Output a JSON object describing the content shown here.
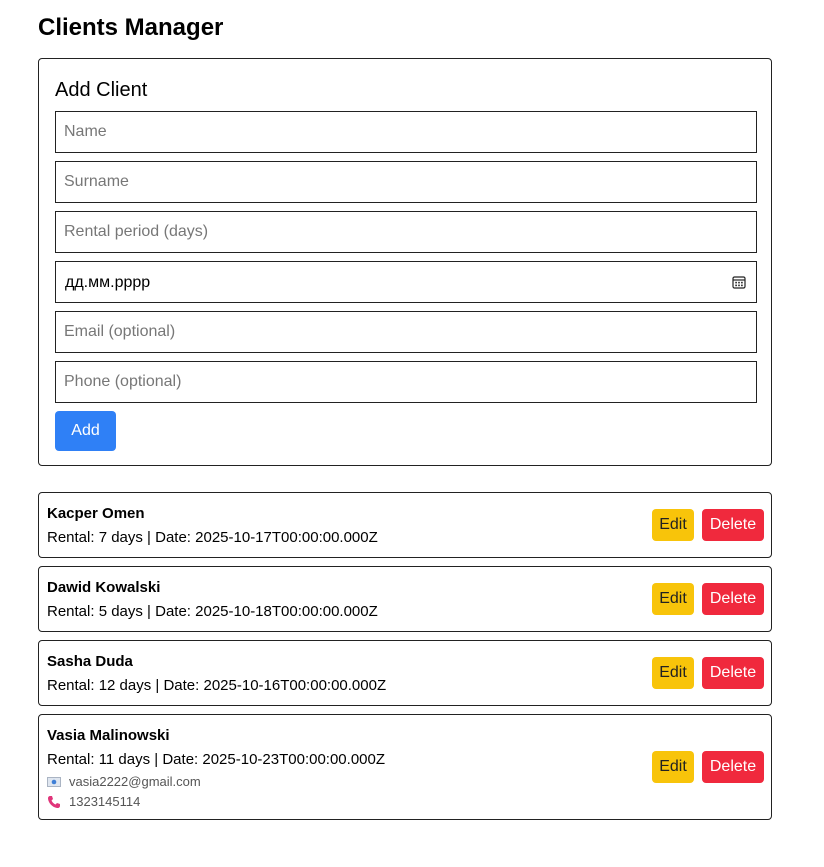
{
  "header": {
    "title": "Clients Manager"
  },
  "form": {
    "title": "Add Client",
    "name_placeholder": "Name",
    "surname_placeholder": "Surname",
    "rental_placeholder": "Rental period (days)",
    "date_value": "дд.мм.рррр",
    "email_placeholder": "Email (optional)",
    "phone_placeholder": "Phone (optional)",
    "add_label": "Add"
  },
  "clients": [
    {
      "name": "Kacper Omen",
      "info": "Rental: 7 days | Date: 2025-10-17T00:00:00.000Z",
      "edit_label": "Edit",
      "delete_label": "Delete"
    },
    {
      "name": "Dawid Kowalski",
      "info": "Rental: 5 days | Date: 2025-10-18T00:00:00.000Z",
      "edit_label": "Edit",
      "delete_label": "Delete"
    },
    {
      "name": "Sasha Duda",
      "info": "Rental: 12 days | Date: 2025-10-16T00:00:00.000Z",
      "edit_label": "Edit",
      "delete_label": "Delete"
    },
    {
      "name": "Vasia Malinowski",
      "info": "Rental: 11 days | Date: 2025-10-23T00:00:00.000Z",
      "email": "vasia2222@gmail.com",
      "phone": "1323145114",
      "edit_label": "Edit",
      "delete_label": "Delete"
    }
  ],
  "colors": {
    "primary": "#2f80f6",
    "warning": "#f8c40a",
    "danger": "#f0293d",
    "phone_icon": "#e0357a"
  },
  "icons": {
    "date": "calendar-icon",
    "email": "email-icon",
    "phone": "phone-icon"
  }
}
